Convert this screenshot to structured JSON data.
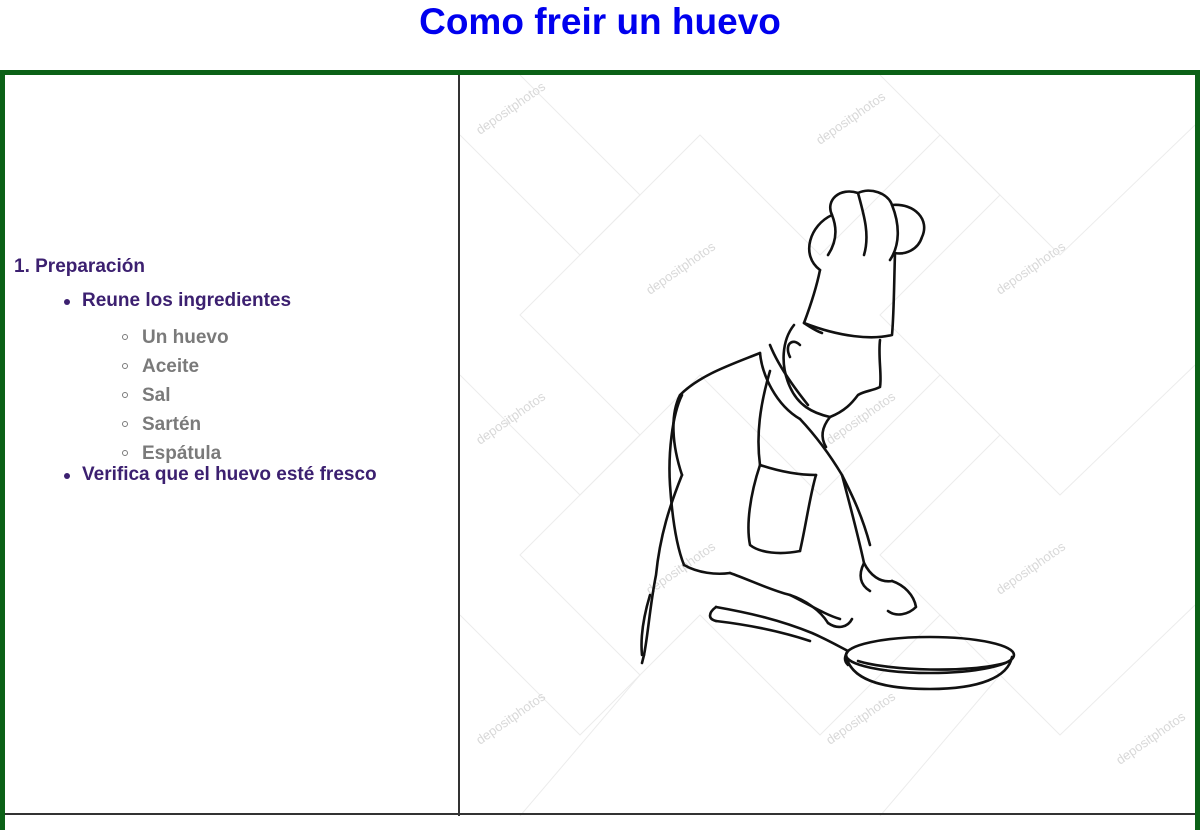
{
  "page": {
    "title": "Como freir un huevo"
  },
  "recipe": {
    "section_title": "1. Preparación",
    "steps": [
      {
        "label": "Reune los ingredientes",
        "ingredients": [
          "Un huevo",
          "Aceite",
          "Sal",
          "Sartén",
          "Espátula"
        ]
      },
      {
        "label": "Verifica que el huevo esté fresco"
      }
    ]
  },
  "illustration": {
    "watermark": "depositphotos",
    "subject": "line drawing of chef holding frying pan"
  },
  "colors": {
    "title": "#0000ee",
    "frame_border": "#0b6116",
    "list_primary": "#3c2070",
    "list_secondary": "#7a7a7a"
  }
}
